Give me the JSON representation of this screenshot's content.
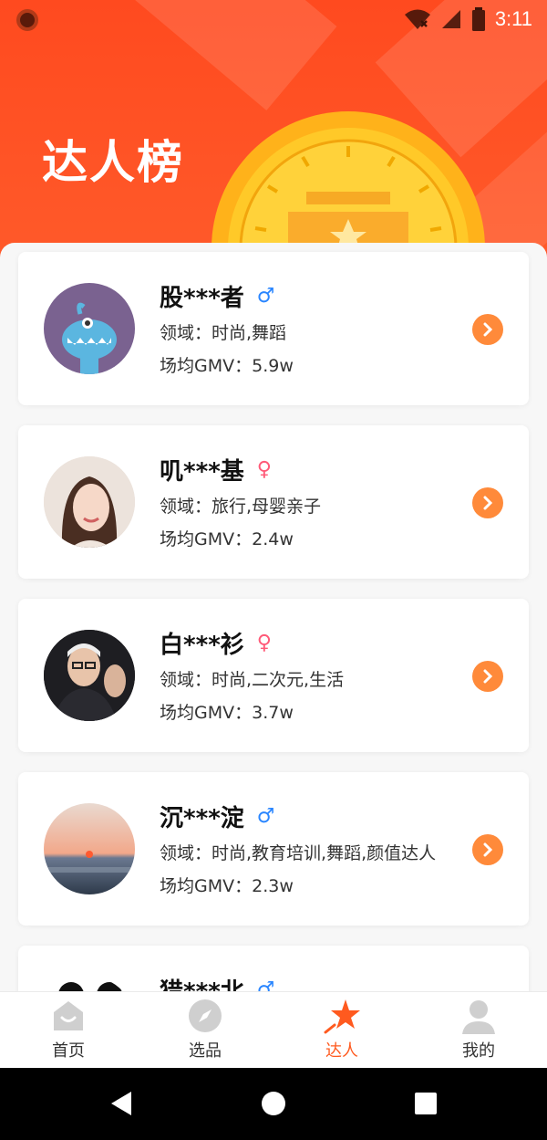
{
  "status_bar": {
    "time": "3:11"
  },
  "header": {
    "title": "达人榜"
  },
  "creators": [
    {
      "name": "股***者",
      "gender": "male",
      "gender_symbol": "♂",
      "field": "领域：时尚,舞蹈",
      "gmv": "场均GMV：5.9w",
      "avatar": "monster-avatar"
    },
    {
      "name": "叽***基",
      "gender": "female",
      "gender_symbol": "♀",
      "field": "领域：旅行,母婴亲子",
      "gmv": "场均GMV：2.4w",
      "avatar": "woman-avatar"
    },
    {
      "name": "白***衫",
      "gender": "female",
      "gender_symbol": "♀",
      "field": "领域：时尚,二次元,生活",
      "gmv": "场均GMV：3.7w",
      "avatar": "man-avatar"
    },
    {
      "name": "沉***淀",
      "gender": "male",
      "gender_symbol": "♂",
      "field": "领域：时尚,教育培训,舞蹈,颜值达人",
      "gmv": "场均GMV：2.3w",
      "avatar": "sunset-avatar"
    },
    {
      "name": "猎***北",
      "gender": "male",
      "gender_symbol": "♂",
      "field": "",
      "gmv": "",
      "avatar": "cartoon-avatar"
    }
  ],
  "bottom_nav": [
    {
      "label": "首页",
      "icon": "home-icon",
      "active": false
    },
    {
      "label": "选品",
      "icon": "compass-icon",
      "active": false
    },
    {
      "label": "达人",
      "icon": "star-icon",
      "active": true
    },
    {
      "label": "我的",
      "icon": "user-icon",
      "active": false
    }
  ],
  "colors": {
    "header": "#ff4a1f",
    "accent": "#ff8a3a",
    "active": "#ff5a1f",
    "male": "#2a86ff",
    "female": "#ff5a78"
  }
}
